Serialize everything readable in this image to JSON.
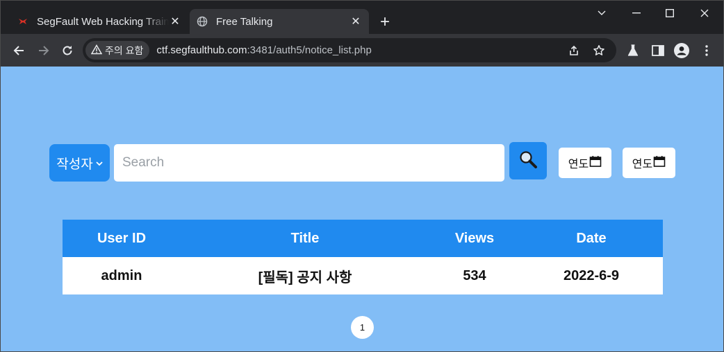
{
  "browser": {
    "tabs": [
      {
        "title": "SegFault Web Hacking Training",
        "active": false,
        "favicon": "segfault-logo-icon"
      },
      {
        "title": "Free Talking",
        "active": true,
        "favicon": "globe-icon"
      }
    ],
    "security_label": "주의 요함",
    "url_host": "ctf.segfaulthub.com",
    "url_rest": ":3481/auth5/notice_list.php"
  },
  "search": {
    "filter_label": "작성자",
    "placeholder": "Search",
    "value": ""
  },
  "date_filters": {
    "start_label": "연도",
    "end_label": "연도"
  },
  "table": {
    "headers": [
      "User ID",
      "Title",
      "Views",
      "Date"
    ],
    "rows": [
      {
        "user_id": "admin",
        "title": "[필독] 공지 사항",
        "views": "534",
        "date": "2022-6-9"
      }
    ]
  },
  "pagination": {
    "pages": [
      "1"
    ]
  },
  "colors": {
    "page_background": "#82bdf6",
    "accent": "#208aef",
    "browser_frame": "#202124",
    "toolbar": "#35363a"
  }
}
